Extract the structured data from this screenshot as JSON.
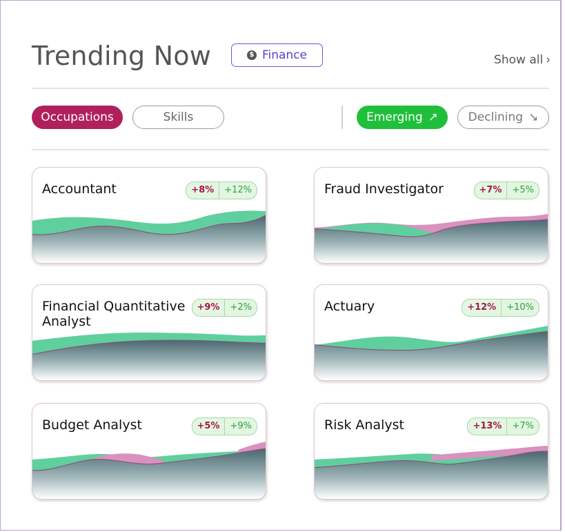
{
  "header": {
    "title": "Trending Now",
    "finance_chip": {
      "label": "Finance",
      "icon": "dollar-icon"
    },
    "show_all": {
      "label": "Show all",
      "icon": "chevron-right-icon"
    }
  },
  "filters": {
    "type_tabs": [
      {
        "label": "Occupations",
        "selected": true
      },
      {
        "label": "Skills",
        "selected": false
      }
    ],
    "trend_tabs": [
      {
        "label": "Emerging",
        "icon": "arrow-up-right-icon",
        "selected": true
      },
      {
        "label": "Declining",
        "icon": "arrow-down-right-icon",
        "selected": false
      }
    ]
  },
  "cards": [
    {
      "title": "Accountant",
      "change_a": "+8%",
      "change_b": "+12%"
    },
    {
      "title": "Fraud Investigator",
      "change_a": "+7%",
      "change_b": "+5%"
    },
    {
      "title": "Financial Quantitative Analyst",
      "change_a": "+9%",
      "change_b": "+2%"
    },
    {
      "title": "Actuary",
      "change_a": "+12%",
      "change_b": "+10%"
    },
    {
      "title": "Budget Analyst",
      "change_a": "+5%",
      "change_b": "+9%"
    },
    {
      "title": "Risk Analyst",
      "change_a": "+13%",
      "change_b": "+7%"
    }
  ],
  "colors": {
    "primary_pill": "#b0205c",
    "emerging_pill": "#1fbf3b",
    "finance_accent": "#5b3fd1",
    "wave_green": "#5fcf9e",
    "wave_pink": "#d991bf",
    "wave_body": "#4d6870"
  }
}
